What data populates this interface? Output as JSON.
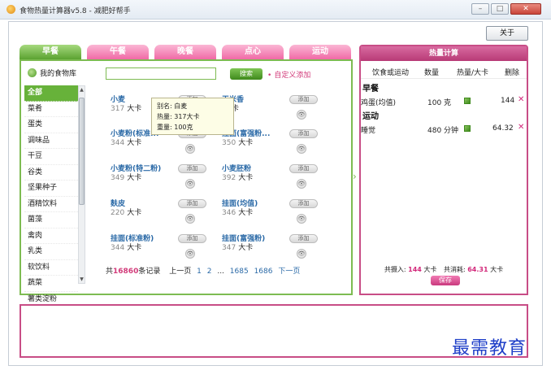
{
  "titlebar": {
    "title": "食物热量计算器v5.8 - 减肥好帮手",
    "buttons": [
      "–",
      "□",
      "✕"
    ]
  },
  "about_button": "关于",
  "tabs": [
    {
      "label": "早餐",
      "active": true
    },
    {
      "label": "午餐",
      "active": false
    },
    {
      "label": "晚餐",
      "active": false
    },
    {
      "label": "点心",
      "active": false
    },
    {
      "label": "运动",
      "active": false
    }
  ],
  "left": {
    "food_library_label": "我的食物库",
    "search": {
      "value": "",
      "placeholder": ""
    },
    "search_button": "搜索",
    "custom_add": "自定义添加",
    "categories": [
      {
        "label": "全部",
        "active": true
      },
      {
        "label": "菜肴"
      },
      {
        "label": "蛋类"
      },
      {
        "label": "调味品"
      },
      {
        "label": "干豆"
      },
      {
        "label": "谷类"
      },
      {
        "label": "坚果种子"
      },
      {
        "label": "酒精饮料"
      },
      {
        "label": "菌藻"
      },
      {
        "label": "禽肉"
      },
      {
        "label": "乳类"
      },
      {
        "label": "软饮料"
      },
      {
        "label": "蔬菜"
      },
      {
        "label": "薯类淀粉"
      }
    ],
    "foods": [
      {
        "name": "小麦",
        "cal": "317",
        "unit": "大卡",
        "add": "添加"
      },
      {
        "name": "玉米香",
        "cal": "",
        "unit": "大卡",
        "add": "添加"
      },
      {
        "name": "小麦粉(标准...",
        "cal": "344",
        "unit": "大卡",
        "add": "添加"
      },
      {
        "name": "挂面(富强粉...",
        "cal": "350",
        "unit": "大卡",
        "add": "添加"
      },
      {
        "name": "小麦粉(特二粉)",
        "cal": "349",
        "unit": "大卡",
        "add": "添加"
      },
      {
        "name": "小麦胚粉",
        "cal": "392",
        "unit": "大卡",
        "add": "添加"
      },
      {
        "name": "麸皮",
        "cal": "220",
        "unit": "大卡",
        "add": "添加"
      },
      {
        "name": "挂面(均值)",
        "cal": "346",
        "unit": "大卡",
        "add": "添加"
      },
      {
        "name": "挂面(标准粉)",
        "cal": "344",
        "unit": "大卡",
        "add": "添加"
      },
      {
        "name": "挂面(富强粉)",
        "cal": "347",
        "unit": "大卡",
        "add": "添加"
      }
    ],
    "tooltip": {
      "alias": "别名: 白麦",
      "calories": "热量: 317大卡",
      "weight": "重量: 100克"
    },
    "pager": {
      "prefix": "共",
      "count": "16860",
      "suffix": "条记录",
      "prev": "上一页",
      "pages": [
        "1",
        "2",
        "...",
        "1685",
        "1686"
      ],
      "next": "下一页"
    }
  },
  "right": {
    "header": "热量计算",
    "columns": [
      "饮食或运动",
      "数量",
      "热量/大卡",
      "删除"
    ],
    "sections": [
      {
        "title": "早餐",
        "rows": [
          {
            "item": "鸡蛋(均值)",
            "qty": "100 克",
            "cal": "144"
          }
        ]
      },
      {
        "title": "运动",
        "rows": [
          {
            "item": "睡觉",
            "qty": "480 分钟",
            "cal": "64.32"
          }
        ]
      }
    ],
    "totals": {
      "in_label": "共摄入:",
      "in_value": "144",
      "in_unit": "大卡",
      "out_label": "共消耗:",
      "out_value": "64.31",
      "out_unit": "大卡"
    },
    "save_button": "保存"
  },
  "watermark": "最需教育",
  "colors": {
    "green": "#67b23a",
    "pink": "#c84d86",
    "link_blue": "#2b6aa7",
    "accent_pink": "#d2287a"
  }
}
